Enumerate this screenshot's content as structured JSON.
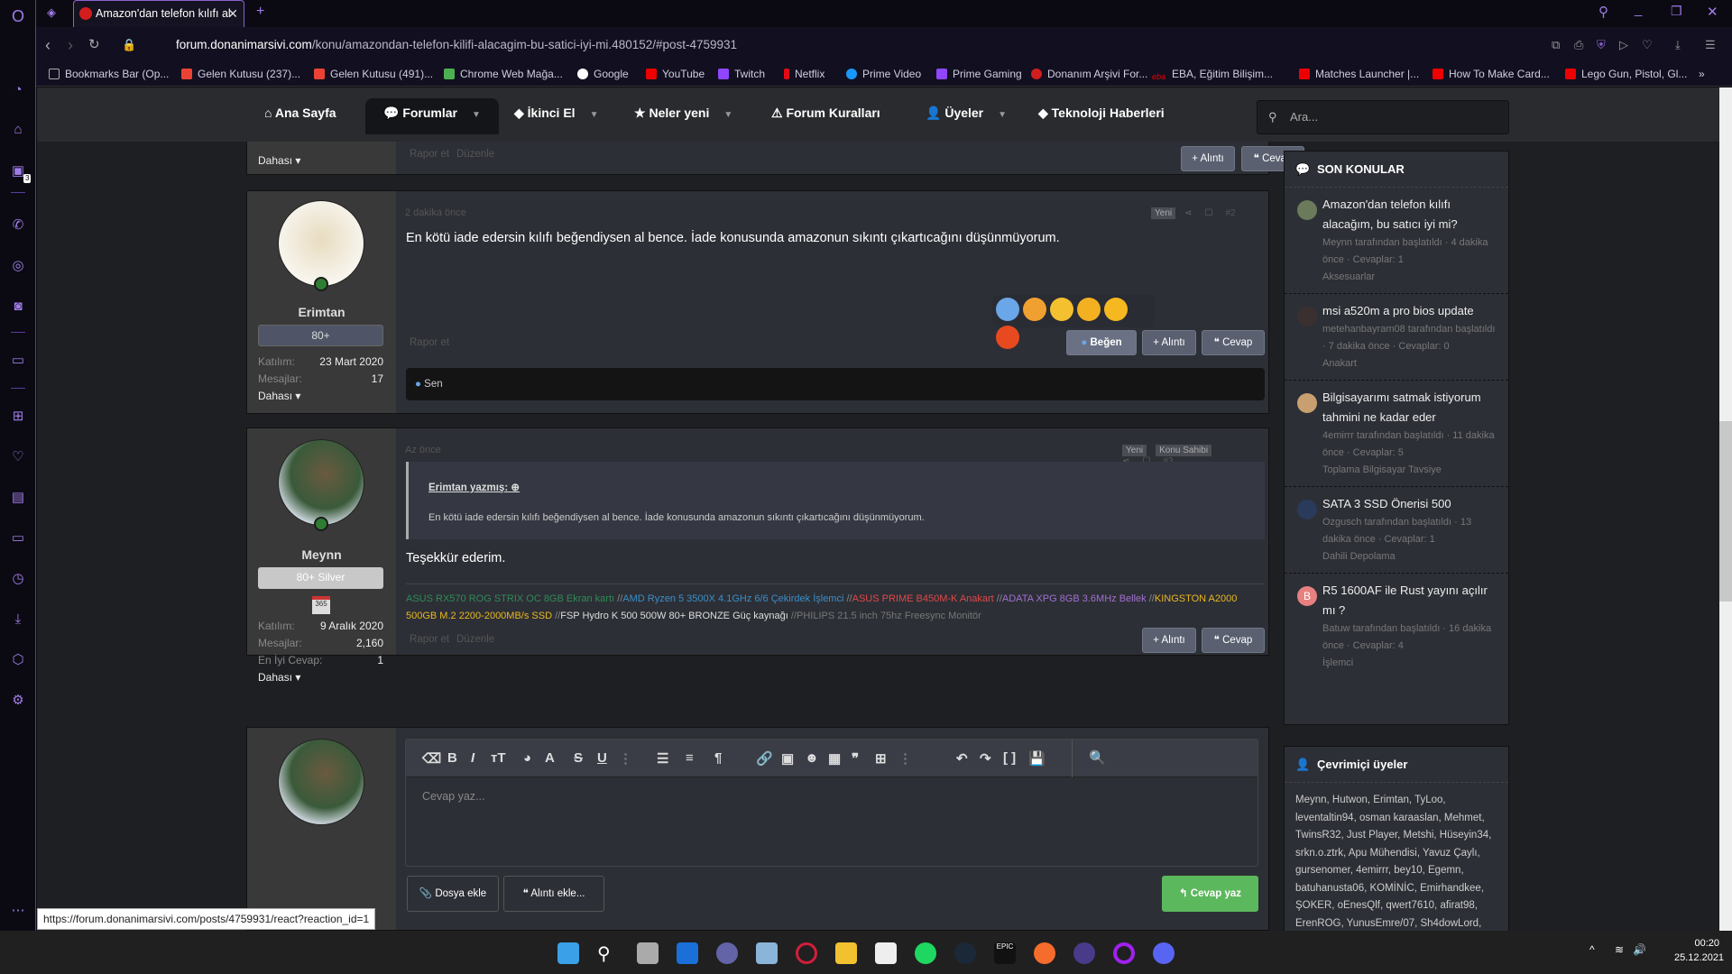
{
  "browser": {
    "tab_title": "Amazon'dan telefon kılıfı al",
    "url_host": "forum.donanimarsivi.com",
    "url_path": "/konu/amazondan-telefon-kilifi-alacagim-bu-satici-iyi-mi.480152/#post-4759931",
    "bookmarks": [
      "Bookmarks Bar (Op...",
      "Gelen Kutusu (237)...",
      "Gelen Kutusu (491)...",
      "Chrome Web Mağa...",
      "Google",
      "YouTube",
      "Twitch",
      "Netflix",
      "Prime Video",
      "Prime Gaming",
      "Donanım Arşivi For...",
      "EBA, Eğitim Bilişim...",
      "Matches Launcher |...",
      "How To Make Card...",
      "Lego Gun, Pistol, Gl..."
    ],
    "sidebar_badge": "3",
    "status_url": "https://forum.donanimarsivi.com/posts/4759931/react?reaction_id=1"
  },
  "nav": {
    "items": [
      "Ana Sayfa",
      "Forumlar",
      "İkinci El",
      "Neler yeni",
      "Forum Kuralları",
      "Üyeler",
      "Teknoloji Haberleri"
    ],
    "search_placeholder": "Ara..."
  },
  "prev_post": {
    "report": "Rapor et",
    "edit": "Düzenle",
    "more": "Dahası",
    "quote": "+ Alıntı",
    "reply": "Cevap"
  },
  "post2": {
    "user": "Erimtan",
    "badge": "80+",
    "joined_label": "Katılım:",
    "joined": "23 Mart 2020",
    "messages_label": "Mesajlar:",
    "messages": "17",
    "more": "Dahası",
    "time": "2 dakika önce",
    "tag_new": "Yeni",
    "number": "#2",
    "text": "En kötü iade edersin kılıfı beğendiysen al bence. İade konusunda amazonun sıkıntı çıkartıcağını düşünmüyorum.",
    "report": "Rapor et",
    "like": "Beğen",
    "quote": "+ Alıntı",
    "reply": "Cevap",
    "reaction_by": "Sen"
  },
  "post3": {
    "user": "Meynn",
    "badge": "80+ Silver",
    "joined_label": "Katılım:",
    "joined": "9 Aralık 2020",
    "messages_label": "Mesajlar:",
    "messages": "2,160",
    "best_label": "En İyi Cevap:",
    "best": "1",
    "more": "Dahası",
    "time": "Az önce",
    "tag_new": "Yeni",
    "tag_owner": "Konu Sahibi",
    "number": "#3",
    "quote_author": "Erimtan yazmış:",
    "quote_text": "En kötü iade edersin kılıfı beğendiysen al bence. İade konusunda amazonun sıkıntı çıkartıcağını düşünmüyorum.",
    "text": "Teşekkür ederim.",
    "signature": [
      {
        "t": "ASUS RX570 ROG STRIX OC 8GB Ekran kartı ",
        "c": "#2e8b57"
      },
      {
        "t": "//",
        "c": "#888"
      },
      {
        "t": "AMD Ryzen 5 3500X 4.1GHz 6/6 Çekirdek İşlemci ",
        "c": "#3a8fc8"
      },
      {
        "t": "//",
        "c": "#888"
      },
      {
        "t": "ASUS PRIME B450M-K Anakart ",
        "c": "#e04848"
      },
      {
        "t": "//",
        "c": "#888"
      },
      {
        "t": "ADATA XPG 8GB 3.6MHz Bellek ",
        "c": "#a070d0"
      },
      {
        "t": "//",
        "c": "#888"
      },
      {
        "t": "KINGSTON A2000 500GB M.2 2200-2000MB/s SSD ",
        "c": "#e8b820"
      },
      {
        "t": "//",
        "c": "#888"
      },
      {
        "t": "FSP Hydro K 500 500W 80+ BRONZE Güç kaynağı ",
        "c": "#dddddd"
      },
      {
        "t": "//PHILIPS 21.5 inch 75hz Freesync Monitör",
        "c": "#777"
      }
    ],
    "report": "Rapor et",
    "edit": "Düzenle",
    "quote": "+ Alıntı",
    "reply": "Cevap"
  },
  "editor": {
    "placeholder": "Cevap yaz...",
    "attach": "Dosya ekle",
    "insert_quote": "Alıntı ekle...",
    "submit": "Cevap yaz"
  },
  "sidebar": {
    "recent_title": "SON KONULAR",
    "threads": [
      {
        "title": "Amazon'dan telefon kılıfı alacağım, bu satıcı iyi mi?",
        "meta": "Meynn tarafından başlatıldı · 4 dakika önce · Cevaplar: 1",
        "forum": "Aksesuarlar"
      },
      {
        "title": "msi a520m a pro bios update",
        "meta": "metehanbayram08 tarafından başlatıldı · 7 dakika önce · Cevaplar: 0",
        "forum": "Anakart"
      },
      {
        "title": "Bilgisayarımı satmak istiyorum tahmini ne kadar eder",
        "meta": "4emirrr tarafından başlatıldı · 11 dakika önce · Cevaplar: 5",
        "forum": "Toplama Bilgisayar Tavsiye"
      },
      {
        "title": "SATA 3 SSD Önerisi 500",
        "meta": "Ozgusch tarafından başlatıldı · 13 dakika önce · Cevaplar: 1",
        "forum": "Dahili Depolama"
      },
      {
        "title": "R5 1600AF ile Rust yayını açılır mı ?",
        "meta": "Batuw tarafından başlatıldı · 16 dakika önce · Cevaplar: 4",
        "forum": "İşlemci",
        "avatar_letter": "B"
      }
    ],
    "online_title": "Çevrimiçi üyeler",
    "online_list": "Meynn, Hutwon, Erimtan, TyLoo, leventaltin94, osman karaaslan, Mehmet, TwinsR32, Just Player, Metshi, Hüseyin34, srkn.o.ztrk, Apu Mühendisi, Yavuz Çaylı, gursenomer, 4emirrr, bey10, Egemn, batuhanusta06, KOMİNİC, Emirhandkee, ŞOKER, oEnesQlf, qwert7610, afirat98, ErenROG, YunusEmre/07, Sh4dowLord,"
  },
  "taskbar": {
    "time": "00:20",
    "date": "25.12.2021"
  }
}
